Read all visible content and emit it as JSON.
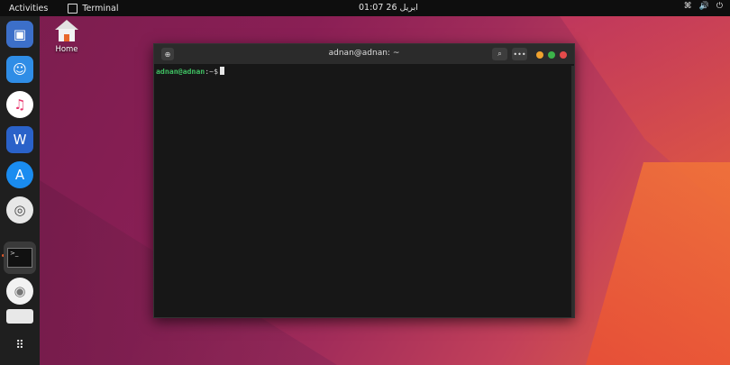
{
  "topbar": {
    "activities": "Activities",
    "app_name": "Terminal",
    "clock": "01:07  26 ابريل",
    "tray": [
      "network-icon",
      "volume-icon",
      "power-icon"
    ]
  },
  "dock": {
    "items": [
      "preview-icon",
      "finder-icon",
      "music-icon",
      "word-icon",
      "app-store-icon",
      "help-icon",
      "terminal-icon",
      "dvd-icon",
      "drive-icon",
      "apps-grid-icon"
    ]
  },
  "desktop": {
    "home_label": "Home"
  },
  "terminal": {
    "title": "adnan@adnan: ~",
    "prompt_user": "adnan@adnan",
    "prompt_path": ":~$",
    "dots": {
      "minimize": "#f0a22e",
      "maximize": "#3cb44a",
      "close": "#e44b4b"
    }
  }
}
